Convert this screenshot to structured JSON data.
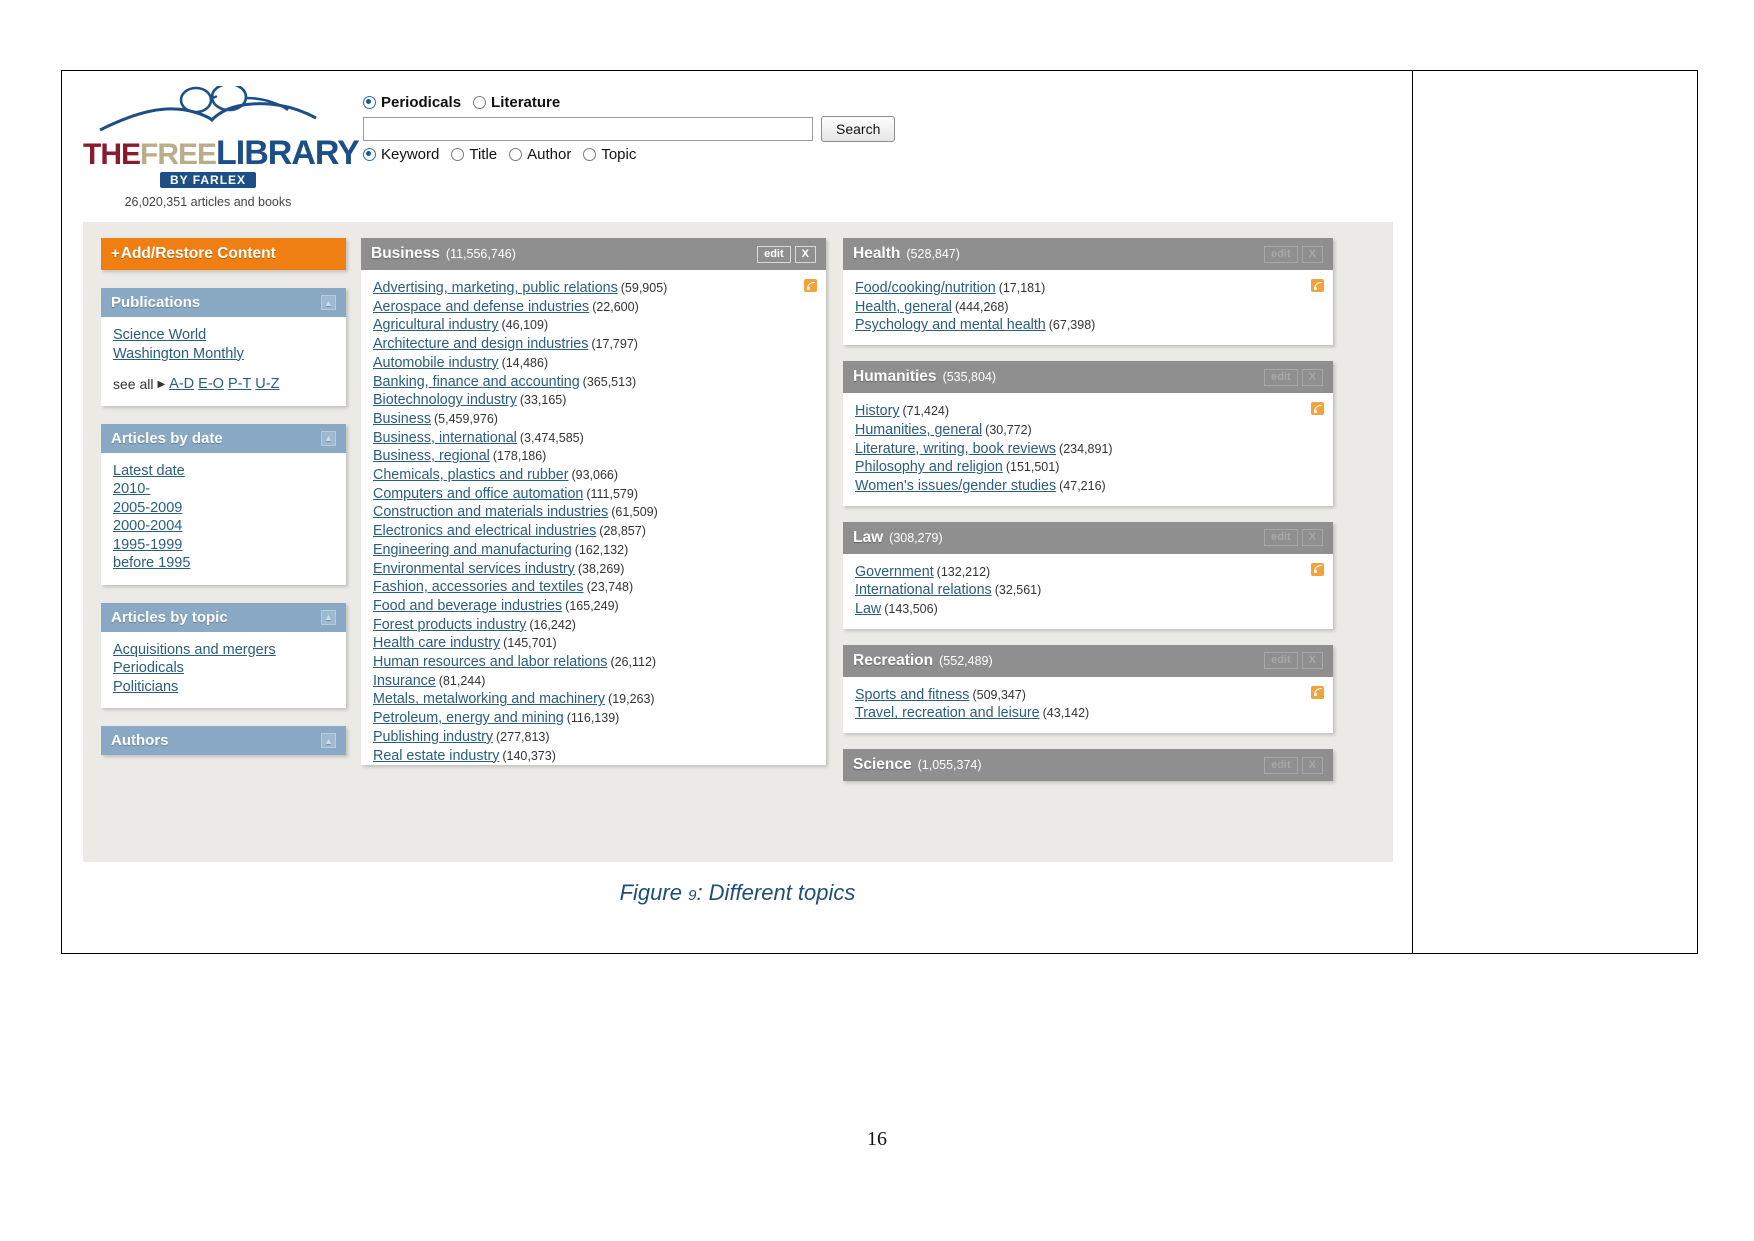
{
  "document": {
    "page_number": "16",
    "caption_prefix": "Figure",
    "caption_number": "9",
    "caption_text": ": Different topics"
  },
  "site": {
    "logo": {
      "the": "THE",
      "free": "FREE",
      "library": "LIBRARY",
      "byline": "BY FARLEX",
      "article_count": "26,020,351 articles and books"
    },
    "search": {
      "scope_options": [
        {
          "label": "Periodicals",
          "selected": true
        },
        {
          "label": "Literature",
          "selected": false
        }
      ],
      "query_value": "",
      "query_placeholder": "",
      "button_label": "Search",
      "field_options": [
        {
          "label": "Keyword",
          "selected": true
        },
        {
          "label": "Title",
          "selected": false
        },
        {
          "label": "Author",
          "selected": false
        },
        {
          "label": "Topic",
          "selected": false
        }
      ]
    }
  },
  "sidebar": {
    "add_restore_label": "Add/Restore Content",
    "add_restore_plus": "+",
    "widgets": [
      {
        "title": "Publications",
        "collapse_glyph": "▲",
        "links": [
          "Science World",
          "Washington Monthly"
        ],
        "see_all_label": "see all",
        "see_all_arrow": "▶",
        "ranges": [
          "A-D",
          "E-O",
          "P-T",
          "U-Z"
        ]
      },
      {
        "title": "Articles by date",
        "collapse_glyph": "▲",
        "links": [
          "Latest date",
          "2010-",
          "2005-2009",
          "2000-2004",
          "1995-1999",
          "before 1995"
        ]
      },
      {
        "title": "Articles by topic",
        "collapse_glyph": "▲",
        "links": [
          "Acquisitions and mergers",
          "Periodicals",
          "Politicians"
        ]
      },
      {
        "title": "Authors",
        "collapse_glyph": "▲",
        "links": []
      }
    ]
  },
  "cards": {
    "edit_label": "edit",
    "close_label": "X",
    "business": {
      "title": "Business",
      "count": "(11,556,746)",
      "active": true,
      "items": [
        {
          "label": "Advertising, marketing, public relations",
          "count": "(59,905)"
        },
        {
          "label": "Aerospace and defense industries",
          "count": "(22,600)"
        },
        {
          "label": "Agricultural industry",
          "count": "(46,109)"
        },
        {
          "label": "Architecture and design industries",
          "count": "(17,797)"
        },
        {
          "label": "Automobile industry",
          "count": "(14,486)"
        },
        {
          "label": "Banking, finance and accounting",
          "count": "(365,513)"
        },
        {
          "label": "Biotechnology industry",
          "count": "(33,165)"
        },
        {
          "label": "Business",
          "count": "(5,459,976)"
        },
        {
          "label": "Business, international",
          "count": "(3,474,585)"
        },
        {
          "label": "Business, regional",
          "count": "(178,186)"
        },
        {
          "label": "Chemicals, plastics and rubber",
          "count": "(93,066)"
        },
        {
          "label": "Computers and office automation",
          "count": "(111,579)"
        },
        {
          "label": "Construction and materials industries",
          "count": "(61,509)"
        },
        {
          "label": "Electronics and electrical industries",
          "count": "(28,857)"
        },
        {
          "label": "Engineering and manufacturing",
          "count": "(162,132)"
        },
        {
          "label": "Environmental services industry",
          "count": "(38,269)"
        },
        {
          "label": "Fashion, accessories and textiles",
          "count": "(23,748)"
        },
        {
          "label": "Food and beverage industries",
          "count": "(165,249)"
        },
        {
          "label": "Forest products industry",
          "count": "(16,242)"
        },
        {
          "label": "Health care industry",
          "count": "(145,701)"
        },
        {
          "label": "Human resources and labor relations",
          "count": "(26,112)"
        },
        {
          "label": "Insurance",
          "count": "(81,244)"
        },
        {
          "label": "Metals, metalworking and machinery",
          "count": "(19,263)"
        },
        {
          "label": "Petroleum, energy and mining",
          "count": "(116,139)"
        },
        {
          "label": "Publishing industry",
          "count": "(277,813)"
        },
        {
          "label": "Real estate industry",
          "count": "(140,373)"
        }
      ]
    },
    "right_column": [
      {
        "title": "Health",
        "count": "(528,847)",
        "items": [
          {
            "label": "Food/cooking/nutrition",
            "count": "(17,181)"
          },
          {
            "label": "Health, general",
            "count": "(444,268)"
          },
          {
            "label": "Psychology and mental health",
            "count": "(67,398)"
          }
        ]
      },
      {
        "title": "Humanities",
        "count": "(535,804)",
        "items": [
          {
            "label": "History",
            "count": "(71,424)"
          },
          {
            "label": "Humanities, general",
            "count": "(30,772)"
          },
          {
            "label": "Literature, writing, book reviews",
            "count": "(234,891)"
          },
          {
            "label": "Philosophy and religion",
            "count": "(151,501)"
          },
          {
            "label": "Women's issues/gender studies",
            "count": "(47,216)"
          }
        ]
      },
      {
        "title": "Law",
        "count": "(308,279)",
        "items": [
          {
            "label": "Government",
            "count": "(132,212)"
          },
          {
            "label": "International relations",
            "count": "(32,561)"
          },
          {
            "label": "Law",
            "count": "(143,506)"
          }
        ]
      },
      {
        "title": "Recreation",
        "count": "(552,489)",
        "items": [
          {
            "label": "Sports and fitness",
            "count": "(509,347)"
          },
          {
            "label": "Travel, recreation and leisure",
            "count": "(43,142)"
          }
        ]
      },
      {
        "title": "Science",
        "count": "(1,055,374)",
        "items": []
      }
    ]
  },
  "colors": {
    "orange": "#f07f13",
    "sidebar_head": "#8aa9c4",
    "card_head": "#8f8f8f",
    "link": "#2b5d7d",
    "caption": "#1f4e79",
    "rss": "#f2a33c"
  }
}
